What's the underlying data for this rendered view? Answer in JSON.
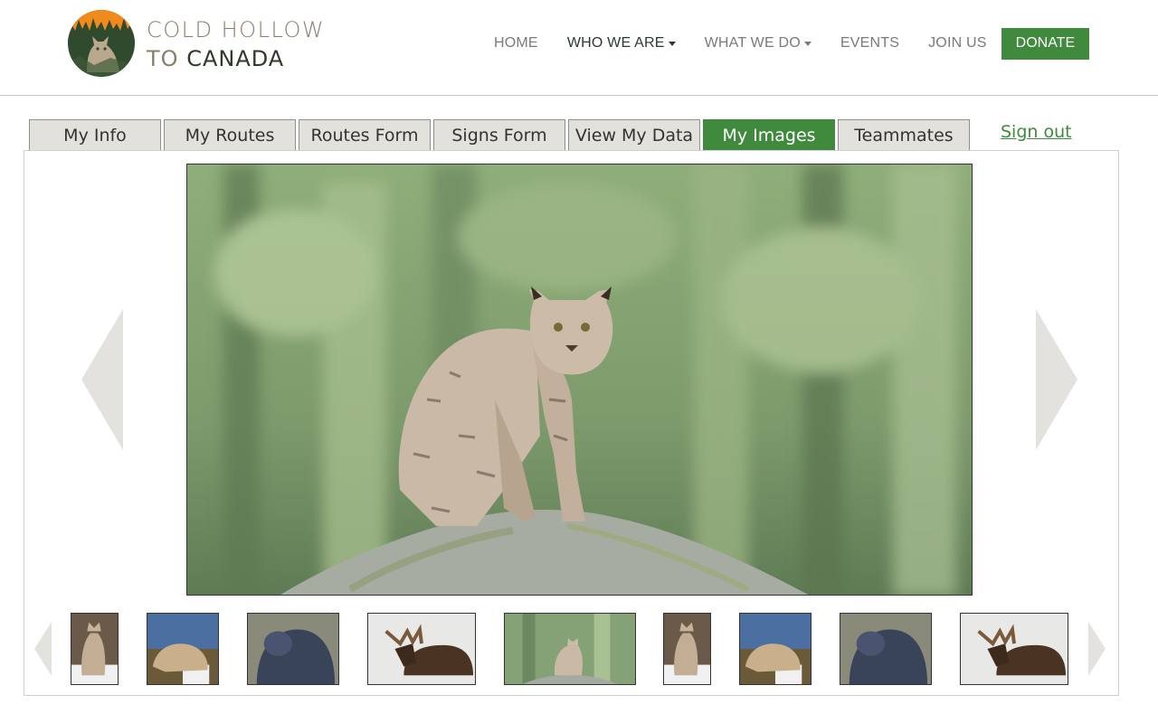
{
  "header": {
    "logo": {
      "line1": "COLD HOLLOW",
      "line2_prefix": "TO",
      "line2_strong": "CANADA"
    },
    "nav": [
      {
        "label": "HOME"
      },
      {
        "label": "WHO WE ARE"
      },
      {
        "label": "WHAT WE DO"
      },
      {
        "label": "EVENTS"
      },
      {
        "label": "JOIN US"
      }
    ],
    "donate_label": "DONATE"
  },
  "tabs": [
    {
      "label": "My Info"
    },
    {
      "label": "My Routes"
    },
    {
      "label": "Routes Form"
    },
    {
      "label": "Signs Form"
    },
    {
      "label": "View My Data"
    },
    {
      "label": "My Images"
    },
    {
      "label": "Teammates"
    }
  ],
  "signout_label": "Sign out",
  "colors": {
    "accent": "#3f8a3c",
    "tab_bg": "#e3e1dc",
    "arrow": "#e4e2df"
  },
  "gallery": {
    "main_image_icon": "bobcat-photo",
    "thumbnails": [
      {
        "icon": "bobcat-snow-photo"
      },
      {
        "icon": "bobcat-crouching-photo"
      },
      {
        "icon": "fisher-photo"
      },
      {
        "icon": "moose-photo"
      },
      {
        "icon": "bobcat-rock-photo"
      },
      {
        "icon": "bobcat-snow-photo"
      },
      {
        "icon": "bobcat-crouching-photo"
      },
      {
        "icon": "fisher-photo"
      },
      {
        "icon": "moose-photo"
      }
    ]
  }
}
